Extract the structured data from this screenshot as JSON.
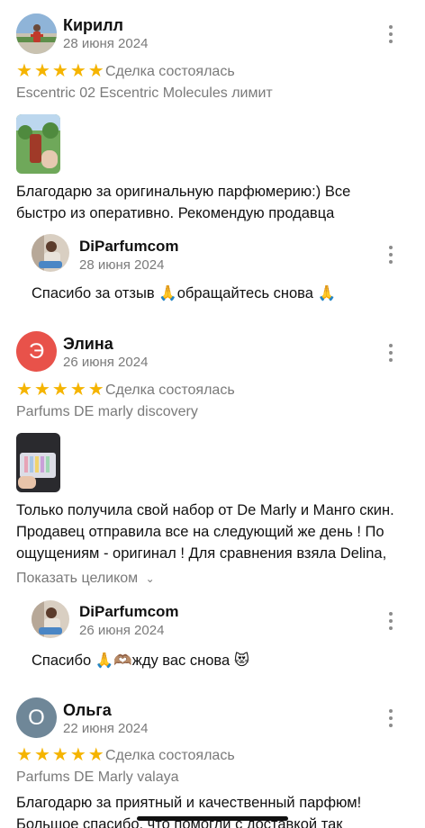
{
  "reviews": [
    {
      "author": "Кирилл",
      "avatar_initial": "",
      "avatar_color": "#9bbad6",
      "date": "28 июня 2024",
      "rating": 5,
      "deal_status": "Сделка состоялась",
      "product": "Escentric 02 Escentric Molecules лимит",
      "text_lines": [
        "Благодарю за оригинальную парфюмерию:) Все",
        "быстро из оперативно. Рекомендую продавца"
      ],
      "reply": {
        "author": "DiParfumcom",
        "date": "28 июня 2024",
        "text": "Спасибо за отзыв 🙏обращайтесь снова 🙏"
      }
    },
    {
      "author": "Элина",
      "avatar_initial": "Э",
      "avatar_color": "#e8524a",
      "date": "26 июня 2024",
      "rating": 5,
      "deal_status": "Сделка состоялась",
      "product": "Parfums DE marly discovery",
      "text_lines": [
        "Только получила свой набор от De Marly и Манго скин.",
        "Продавец отправила все на следующий же день ! По",
        "ощущениям - оригинал ! Для сравнения взяла Delina,"
      ],
      "show_more": "Показать целиком",
      "reply": {
        "author": "DiParfumcom",
        "date": "26 июня 2024",
        "text": "Спасибо 🙏🫶🏽жду вас снова 😻"
      }
    },
    {
      "author": "Ольга",
      "avatar_initial": "О",
      "avatar_color": "#6f8798",
      "date": "22 июня 2024",
      "rating": 5,
      "deal_status": "Сделка состоялась",
      "product": "Parfums DE Marly valaya",
      "text_lines": [
        "Благодарю за приятный и качественный парфюм!",
        "Большое спасибо, что помогли с доставкой так"
      ]
    }
  ],
  "icons": {
    "star": "star-icon",
    "more": "more-vertical-icon",
    "chevron": "chevron-down-icon"
  },
  "colors": {
    "star": "#f5b400",
    "muted_text": "#7a7a7a"
  }
}
